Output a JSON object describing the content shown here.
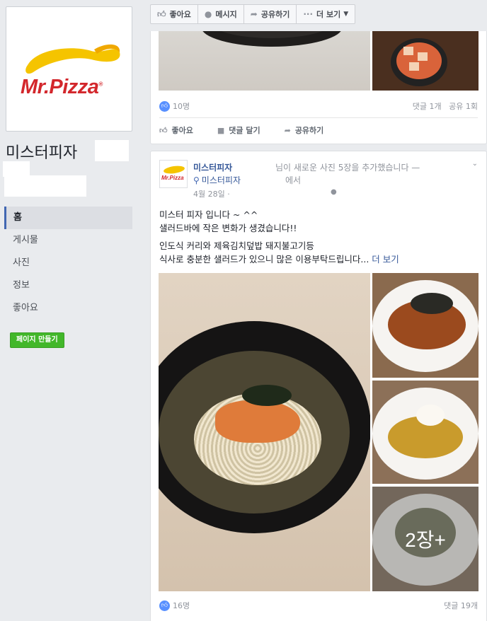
{
  "page": {
    "logo_text": "Mr.Pizza",
    "logo_reg": "®",
    "name": "미스터피자"
  },
  "nav": {
    "items": [
      {
        "label": "홈",
        "active": true
      },
      {
        "label": "게시물",
        "active": false
      },
      {
        "label": "사진",
        "active": false
      },
      {
        "label": "정보",
        "active": false
      },
      {
        "label": "좋아요",
        "active": false
      }
    ],
    "create_page": "페이지 만들기"
  },
  "action_bar": {
    "like": "좋아요",
    "message": "메시지",
    "share": "공유하기",
    "more": "더 보기"
  },
  "post1": {
    "likes": "10명",
    "comments": "댓글 1개",
    "shares": "공유 1회",
    "ufi": {
      "like": "좋아요",
      "comment": "댓글 달기",
      "share": "공유하기"
    }
  },
  "post2": {
    "author": "미스터피자",
    "action_text": "님이 새로운 사진 5장을 추가했습니다 —",
    "location": "미스터피자",
    "location_suffix": "에서",
    "date": "4월 28일 ·",
    "text_lines": [
      "미스터 피자                입니다 ~ ^^",
      "            샐러드바에 작은 변화가 생겼습니다!!",
      "",
      "인도식 커리와 제육김치덮밥 돼지불고기등",
      "식사로 충분한 샐러드가 있으니 많은 이용부탁드립니다..."
    ],
    "see_more": "더 보기",
    "more_photos": "2장+",
    "likes": "16명",
    "comments": "댓글 19개"
  },
  "colors": {
    "brand_red": "#d3272c",
    "brand_yellow": "#f5c400",
    "link_blue": "#365899",
    "fb_blue": "#4267b2",
    "create_green": "#42b72a"
  }
}
